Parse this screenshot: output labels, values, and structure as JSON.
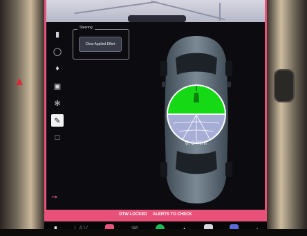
{
  "service_panel": {
    "title": "Steering",
    "button_label": "Clear Applied Effort"
  },
  "torque_gauge": {
    "readout": "0.0 Nm",
    "fill_color": "#16d916",
    "lower_color": "#a7aed6"
  },
  "status_bar": {
    "items": [
      "DTW LOCKED",
      "ALERTS TO CHECK"
    ]
  },
  "dock": {
    "text_label": "LAV",
    "icons": [
      "car-icon",
      "chevron-up-icon",
      "service-wrench-icon",
      "phone-icon",
      "spotify-icon",
      "joystick-icon",
      "app-square-icon",
      "camera-app-icon",
      "volume-icon"
    ]
  },
  "sidebar": {
    "icons": [
      "car-icon",
      "lights-icon",
      "climate-icon",
      "display-icon",
      "settings-icon",
      "service-pencil-icon",
      "battery-icon",
      "logout-icon"
    ],
    "active_index": 5
  },
  "colors": {
    "screen_border": "#e8527a",
    "status_bar": "#e8527a",
    "torque_fill": "#16d916"
  }
}
